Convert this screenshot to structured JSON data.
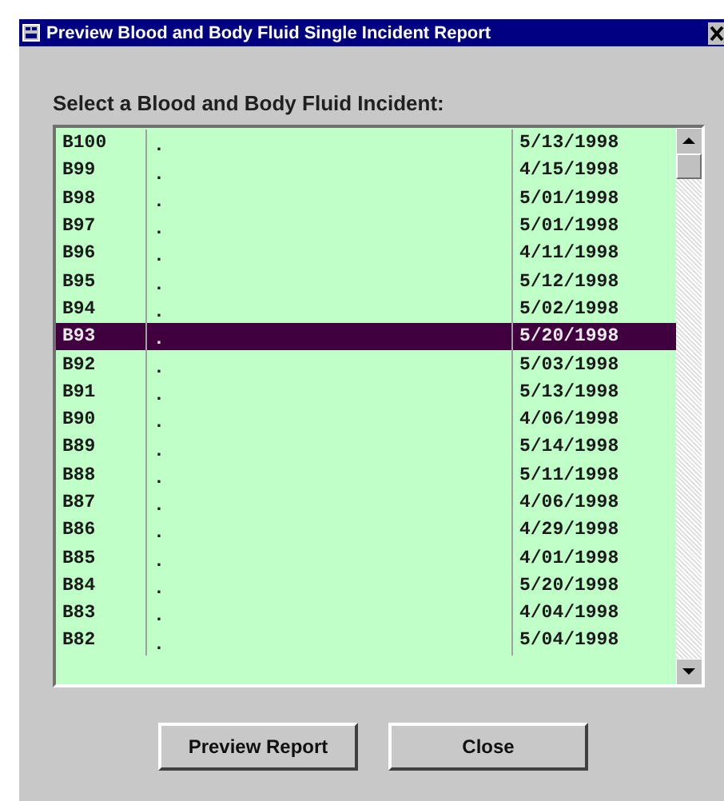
{
  "window": {
    "title": "Preview Blood and Body Fluid Single Incident Report"
  },
  "list": {
    "label": "Select a Blood and Body Fluid Incident:",
    "rows": [
      {
        "id": "B100",
        "column_2": ".",
        "date": "5/13/1998",
        "selected": false
      },
      {
        "id": "B99",
        "column_2": ".",
        "date": "4/15/1998",
        "selected": false
      },
      {
        "id": "B98",
        "column_2": ".",
        "date": "5/01/1998",
        "selected": false
      },
      {
        "id": "B97",
        "column_2": ".",
        "date": "5/01/1998",
        "selected": false
      },
      {
        "id": "B96",
        "column_2": ".",
        "date": "4/11/1998",
        "selected": false
      },
      {
        "id": "B95",
        "column_2": ".",
        "date": "5/12/1998",
        "selected": false
      },
      {
        "id": "B94",
        "column_2": ".",
        "date": "5/02/1998",
        "selected": false
      },
      {
        "id": "B93",
        "column_2": ".",
        "date": "5/20/1998",
        "selected": true
      },
      {
        "id": "B92",
        "column_2": ".",
        "date": "5/03/1998",
        "selected": false
      },
      {
        "id": "B91",
        "column_2": ".",
        "date": "5/13/1998",
        "selected": false
      },
      {
        "id": "B90",
        "column_2": ".",
        "date": "4/06/1998",
        "selected": false
      },
      {
        "id": "B89",
        "column_2": ".",
        "date": "5/14/1998",
        "selected": false
      },
      {
        "id": "B88",
        "column_2": ".",
        "date": "5/11/1998",
        "selected": false
      },
      {
        "id": "B87",
        "column_2": ".",
        "date": "4/06/1998",
        "selected": false
      },
      {
        "id": "B86",
        "column_2": ".",
        "date": "4/29/1998",
        "selected": false
      },
      {
        "id": "B85",
        "column_2": ".",
        "date": "4/01/1998",
        "selected": false
      },
      {
        "id": "B84",
        "column_2": ".",
        "date": "5/20/1998",
        "selected": false
      },
      {
        "id": "B83",
        "column_2": ".",
        "date": "4/04/1998",
        "selected": false
      },
      {
        "id": "B82",
        "column_2": ".",
        "date": "5/04/1998",
        "selected": false
      }
    ]
  },
  "buttons": [
    "Preview Report",
    "Close"
  ]
}
